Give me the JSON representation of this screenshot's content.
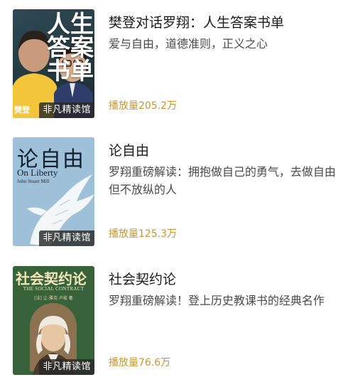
{
  "items": [
    {
      "title": "樊登对话罗翔：人生答案书单",
      "description": "爱与自由，道德准则，正义之心",
      "plays": "播放量205.2万",
      "cover": {
        "big_title": "人生答案书单",
        "side_text": "樊登",
        "tag": "非凡精读馆"
      }
    },
    {
      "title": "论自由",
      "description": "罗翔重磅解读：拥抱做自己的勇气，去做自由但不放纵的人",
      "plays": "播放量125.3万",
      "cover": {
        "title_cn": "论自由",
        "title_en": "On Liberty",
        "author": "John Stuart Mill",
        "tag": "非凡精读馆"
      }
    },
    {
      "title": "社会契约论",
      "description": "罗翔重磅解读！登上历史教课书的经典名作",
      "plays": "播放量76.6万",
      "cover": {
        "title_cn": "社会契约论",
        "title_en": "THE SOCIAL CONTRACT",
        "author": "[法] 让-雅克·卢梭 著",
        "tag": "非凡精读馆"
      }
    }
  ],
  "colors": {
    "plays": "#c8962e",
    "title": "#1b1b1b",
    "description": "#4a4a4a"
  }
}
